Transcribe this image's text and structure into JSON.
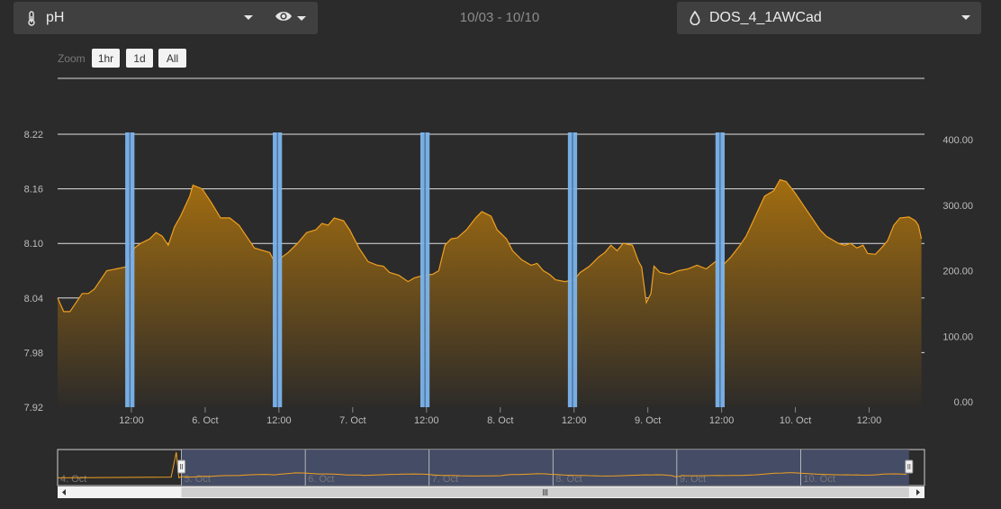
{
  "toolbar": {
    "parameter_label": "pH",
    "date_range": "10/03 - 10/10",
    "probe_label": "DOS_4_1AWCad",
    "parameter_icon": "thermometer-icon",
    "view_icon": "eye-icon",
    "probe_icon": "droplet-icon"
  },
  "zoom": {
    "label": "Zoom",
    "buttons": [
      "1hr",
      "1d",
      "All"
    ]
  },
  "colors": {
    "background": "#2b2b2b",
    "series": "#f0a020",
    "bands": "#7cb4ec"
  },
  "chart_data": {
    "type": "area",
    "series": [
      {
        "axis": "left",
        "points": [
          [
            "2024-10-05 00:00",
            8.04
          ],
          [
            "2024-10-05 01:00",
            8.025
          ],
          [
            "2024-10-05 02:00",
            8.025
          ],
          [
            "2024-10-05 03:30",
            8.04
          ],
          [
            "2024-10-05 04:00",
            8.045
          ],
          [
            "2024-10-05 05:00",
            8.045
          ],
          [
            "2024-10-05 06:00",
            8.05
          ],
          [
            "2024-10-05 07:00",
            8.06
          ],
          [
            "2024-10-05 08:00",
            8.07
          ],
          [
            "2024-10-05 09:30",
            8.072
          ],
          [
            "2024-10-05 11:00",
            8.074
          ],
          [
            "2024-10-05 12:30",
            8.095
          ],
          [
            "2024-10-05 13:30",
            8.1
          ],
          [
            "2024-10-05 15:00",
            8.105
          ],
          [
            "2024-10-05 16:00",
            8.112
          ],
          [
            "2024-10-05 17:00",
            8.108
          ],
          [
            "2024-10-05 18:00",
            8.098
          ],
          [
            "2024-10-05 19:00",
            8.118
          ],
          [
            "2024-10-05 20:00",
            8.13
          ],
          [
            "2024-10-05 21:30",
            8.152
          ],
          [
            "2024-10-05 22:00",
            8.164
          ],
          [
            "2024-10-05 23:30",
            8.16
          ],
          [
            "2024-10-06 01:00",
            8.145
          ],
          [
            "2024-10-06 02:30",
            8.128
          ],
          [
            "2024-10-06 04:00",
            8.128
          ],
          [
            "2024-10-06 05:30",
            8.12
          ],
          [
            "2024-10-06 07:00",
            8.105
          ],
          [
            "2024-10-06 08:00",
            8.095
          ],
          [
            "2024-10-06 09:00",
            8.093
          ],
          [
            "2024-10-06 10:30",
            8.09
          ],
          [
            "2024-10-06 11:30",
            8.077
          ],
          [
            "2024-10-06 12:30",
            8.085
          ],
          [
            "2024-10-06 13:30",
            8.09
          ],
          [
            "2024-10-06 15:00",
            8.1
          ],
          [
            "2024-10-06 16:30",
            8.112
          ],
          [
            "2024-10-06 18:00",
            8.115
          ],
          [
            "2024-10-06 19:00",
            8.122
          ],
          [
            "2024-10-06 20:00",
            8.12
          ],
          [
            "2024-10-06 21:00",
            8.128
          ],
          [
            "2024-10-06 22:30",
            8.125
          ],
          [
            "2024-10-06 23:30",
            8.115
          ],
          [
            "2024-10-07 01:00",
            8.095
          ],
          [
            "2024-10-07 02:30",
            8.08
          ],
          [
            "2024-10-07 04:00",
            8.076
          ],
          [
            "2024-10-07 05:00",
            8.075
          ],
          [
            "2024-10-07 06:00",
            8.068
          ],
          [
            "2024-10-07 07:30",
            8.065
          ],
          [
            "2024-10-07 09:00",
            8.058
          ],
          [
            "2024-10-07 10:00",
            8.062
          ],
          [
            "2024-10-07 11:30",
            8.065
          ],
          [
            "2024-10-07 13:00",
            8.066
          ],
          [
            "2024-10-07 14:00",
            8.07
          ],
          [
            "2024-10-07 15:00",
            8.098
          ],
          [
            "2024-10-07 16:00",
            8.105
          ],
          [
            "2024-10-07 17:00",
            8.106
          ],
          [
            "2024-10-07 18:30",
            8.115
          ],
          [
            "2024-10-07 20:00",
            8.128
          ],
          [
            "2024-10-07 21:00",
            8.135
          ],
          [
            "2024-10-07 22:30",
            8.13
          ],
          [
            "2024-10-07 23:30",
            8.115
          ],
          [
            "2024-10-08 01:00",
            8.105
          ],
          [
            "2024-10-08 02:00",
            8.092
          ],
          [
            "2024-10-08 03:30",
            8.082
          ],
          [
            "2024-10-08 05:00",
            8.076
          ],
          [
            "2024-10-08 06:00",
            8.078
          ],
          [
            "2024-10-08 07:00",
            8.07
          ],
          [
            "2024-10-08 08:00",
            8.066
          ],
          [
            "2024-10-08 09:00",
            8.06
          ],
          [
            "2024-10-08 10:30",
            8.058
          ],
          [
            "2024-10-08 12:00",
            8.06
          ],
          [
            "2024-10-08 13:00",
            8.068
          ],
          [
            "2024-10-08 14:30",
            8.075
          ],
          [
            "2024-10-08 16:00",
            8.085
          ],
          [
            "2024-10-08 17:00",
            8.09
          ],
          [
            "2024-10-08 18:00",
            8.098
          ],
          [
            "2024-10-08 19:00",
            8.092
          ],
          [
            "2024-10-08 20:00",
            8.1
          ],
          [
            "2024-10-08 21:30",
            8.098
          ],
          [
            "2024-10-08 22:30",
            8.08
          ],
          [
            "2024-10-08 23:00",
            8.074
          ],
          [
            "2024-10-08 23:45",
            8.035
          ],
          [
            "2024-10-09 00:30",
            8.045
          ],
          [
            "2024-10-09 01:00",
            8.075
          ],
          [
            "2024-10-09 02:00",
            8.068
          ],
          [
            "2024-10-09 03:30",
            8.066
          ],
          [
            "2024-10-09 05:00",
            8.07
          ],
          [
            "2024-10-09 06:30",
            8.072
          ],
          [
            "2024-10-09 08:00",
            8.076
          ],
          [
            "2024-10-09 09:30",
            8.072
          ],
          [
            "2024-10-09 11:00",
            8.08
          ],
          [
            "2024-10-09 12:30",
            8.078
          ],
          [
            "2024-10-09 13:30",
            8.085
          ],
          [
            "2024-10-09 15:00",
            8.098
          ],
          [
            "2024-10-09 16:00",
            8.108
          ],
          [
            "2024-10-09 17:30",
            8.13
          ],
          [
            "2024-10-09 19:00",
            8.152
          ],
          [
            "2024-10-09 20:30",
            8.158
          ],
          [
            "2024-10-09 21:30",
            8.17
          ],
          [
            "2024-10-09 22:30",
            8.168
          ],
          [
            "2024-10-10 00:00",
            8.155
          ],
          [
            "2024-10-10 01:30",
            8.14
          ],
          [
            "2024-10-10 03:00",
            8.125
          ],
          [
            "2024-10-10 04:00",
            8.115
          ],
          [
            "2024-10-10 05:00",
            8.108
          ],
          [
            "2024-10-10 06:00",
            8.104
          ],
          [
            "2024-10-10 07:00",
            8.1
          ],
          [
            "2024-10-10 08:00",
            8.098
          ],
          [
            "2024-10-10 09:00",
            8.1
          ],
          [
            "2024-10-10 10:00",
            8.095
          ],
          [
            "2024-10-10 11:00",
            8.098
          ],
          [
            "2024-10-10 11:45",
            8.089
          ],
          [
            "2024-10-10 13:00",
            8.088
          ],
          [
            "2024-10-10 14:00",
            8.095
          ],
          [
            "2024-10-10 15:00",
            8.103
          ],
          [
            "2024-10-10 16:00",
            8.12
          ],
          [
            "2024-10-10 17:00",
            8.128
          ],
          [
            "2024-10-10 18:30",
            8.129
          ],
          [
            "2024-10-10 19:30",
            8.125
          ],
          [
            "2024-10-10 20:00",
            8.12
          ],
          [
            "2024-10-10 20:30",
            8.105
          ]
        ]
      }
    ],
    "bands": [
      {
        "from": "2024-10-05 11:00",
        "to": "2024-10-05 12:30"
      },
      {
        "from": "2024-10-06 11:00",
        "to": "2024-10-06 12:30"
      },
      {
        "from": "2024-10-07 11:00",
        "to": "2024-10-07 12:30"
      },
      {
        "from": "2024-10-08 11:00",
        "to": "2024-10-08 12:30"
      },
      {
        "from": "2024-10-09 11:00",
        "to": "2024-10-09 12:30"
      }
    ],
    "x_range": [
      "2024-10-05 00:00",
      "2024-10-10 21:00"
    ],
    "xaxis_ticks": [
      {
        "at": "2024-10-05 12:00",
        "label": "12:00"
      },
      {
        "at": "2024-10-06 00:00",
        "label": "6. Oct"
      },
      {
        "at": "2024-10-06 12:00",
        "label": "12:00"
      },
      {
        "at": "2024-10-07 00:00",
        "label": "7. Oct"
      },
      {
        "at": "2024-10-07 12:00",
        "label": "12:00"
      },
      {
        "at": "2024-10-08 00:00",
        "label": "8. Oct"
      },
      {
        "at": "2024-10-08 12:00",
        "label": "12:00"
      },
      {
        "at": "2024-10-09 00:00",
        "label": "9. Oct"
      },
      {
        "at": "2024-10-09 12:00",
        "label": "12:00"
      },
      {
        "at": "2024-10-10 00:00",
        "label": "10. Oct"
      },
      {
        "at": "2024-10-10 12:00",
        "label": "12:00"
      }
    ],
    "y_left": {
      "ticks": [
        "8.22",
        "8.16",
        "8.10",
        "8.04",
        "7.98",
        "7.92"
      ],
      "range": [
        7.92,
        8.22
      ]
    },
    "y_right": {
      "ticks": [
        "400.00",
        "300.00",
        "200.00",
        "100.00",
        "0.00"
      ],
      "range": [
        0,
        400
      ]
    },
    "grid": true,
    "navigator": {
      "x_range": [
        "2024-10-04 00:00",
        "2024-10-11 00:00"
      ],
      "selected": [
        "2024-10-05 00:00",
        "2024-10-10 21:00"
      ],
      "labels": [
        {
          "at": "2024-10-04 00:00",
          "label": "4. Oct"
        },
        {
          "at": "2024-10-05 00:00",
          "label": "5. Oct"
        },
        {
          "at": "2024-10-06 00:00",
          "label": "6. Oct"
        },
        {
          "at": "2024-10-07 00:00",
          "label": "7. Oct"
        },
        {
          "at": "2024-10-08 00:00",
          "label": "8. Oct"
        },
        {
          "at": "2024-10-09 00:00",
          "label": "9. Oct"
        },
        {
          "at": "2024-10-10 00:00",
          "label": "10. Oct"
        }
      ]
    }
  }
}
